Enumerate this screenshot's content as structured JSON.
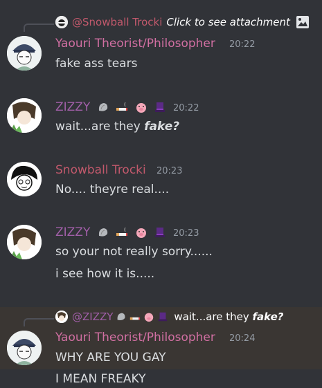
{
  "colors": {
    "background": "#313338",
    "highlight": "#3a3633",
    "yaouri_name": "#d16fa2",
    "zizzy_name": "#a15fa8",
    "snowball_name": "#c2596c",
    "timestamp": "#949ba4",
    "text": "#dbdee1"
  },
  "messages": {
    "m1": {
      "reply_author": "@Snowball Trocki",
      "reply_text": "Click to see attachment",
      "reply_icon": "image-icon",
      "author": "Yaouri Theorist/Philosopher",
      "time": "20:22",
      "lines": [
        "fake ass tears"
      ]
    },
    "m2": {
      "author": "ZIZZY",
      "badges": [
        "shell",
        "cigarette",
        "pig",
        "hat"
      ],
      "time": "20:22",
      "line_prefix": "wait...are they ",
      "line_emph": "fake?"
    },
    "m3": {
      "author": "Snowball Trocki",
      "time": "20:23",
      "lines": [
        "No.... theyre real...."
      ]
    },
    "m4": {
      "author": "ZIZZY",
      "badges": [
        "shell",
        "cigarette",
        "pig",
        "hat"
      ],
      "time": "20:23",
      "lines": [
        "so your not really sorry......",
        "i see how it is....."
      ]
    },
    "m5": {
      "reply_author": "@ZIZZY",
      "reply_prefix": "wait...are they ",
      "reply_emph": "fake?",
      "author": "Yaouri Theorist/Philosopher",
      "time": "20:24",
      "lines": [
        "WHY ARE YOU GAY",
        "I MEAN FREAKY"
      ]
    }
  }
}
